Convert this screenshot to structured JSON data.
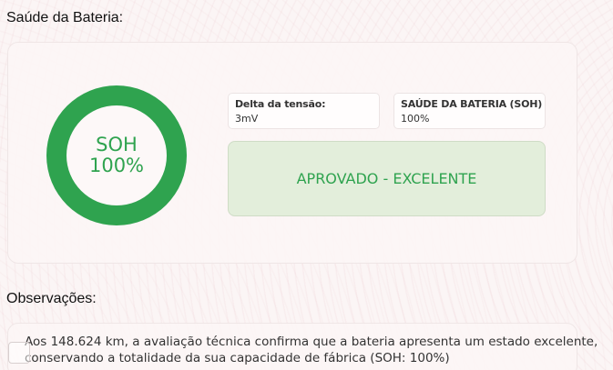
{
  "battery_section": {
    "title": "Saúde da Bateria:",
    "gauge": {
      "label": "SOH",
      "value_text": "100%",
      "fill_fraction": 1.0,
      "color": "#2fa34f"
    },
    "delta": {
      "label": "Delta da tensão:",
      "value": "3mV"
    },
    "soh": {
      "label": "SAÚDE DA BATERIA (SOH)",
      "value": "100%"
    },
    "status": {
      "text": "APROVADO - EXCELENTE",
      "text_color": "#2fa34f",
      "background": "#e3eedb"
    }
  },
  "observations_section": {
    "title": "Observações:",
    "line1": "Aos 148.624 km, a avaliação técnica confirma que a bateria apresenta um estado excelente,",
    "line2": "conservando a totalidade da sua capacidade de fábrica (SOH: 100%)"
  }
}
